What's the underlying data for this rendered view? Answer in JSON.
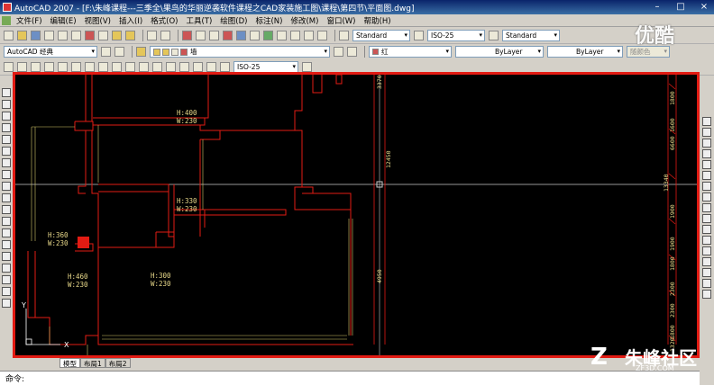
{
  "window": {
    "title": "AutoCAD 2007 - [F:\\朱峰课程---三季全\\果鸟的华丽逆袭软件课程之CAD家装施工图\\课程\\第四节\\平面图.dwg]"
  },
  "menu": [
    "文件(F)",
    "编辑(E)",
    "视图(V)",
    "插入(I)",
    "格式(O)",
    "工具(T)",
    "绘图(D)",
    "标注(N)",
    "修改(M)",
    "窗口(W)",
    "帮助(H)"
  ],
  "toolbar1": {
    "text_style": "Standard",
    "dim_style": "ISO-25",
    "table_style": "Standard"
  },
  "toolbar2": {
    "workspace": "AutoCAD 经典",
    "layer": "墙",
    "color": "红",
    "linetype": "ByLayer",
    "lineweight": "ByLayer",
    "plotstyle": "随颜色"
  },
  "toolbar3": {
    "dim_style": "ISO-25"
  },
  "drawing": {
    "room_labels": [
      {
        "h": "H:400",
        "w": "W:230"
      },
      {
        "h": "H:330",
        "w": "W:230"
      },
      {
        "h": "H:360",
        "w": "W:230"
      },
      {
        "h": "H:460",
        "w": "W:230"
      },
      {
        "h": "H:300",
        "w": "W:230"
      }
    ],
    "dimensions": [
      "3370",
      "12450",
      "4950",
      "13340",
      "1800",
      "1600",
      "6600",
      "1900",
      "1900",
      "1800",
      "2300",
      "2300",
      "1800",
      "1320"
    ],
    "ucs": {
      "x": "X",
      "y": "Y"
    },
    "colors": {
      "wall": "#e21b13",
      "text": "#e9d98a",
      "dim": "#d4c86a",
      "crosshair": "#c8c8c8"
    }
  },
  "layout_tabs": [
    "模型",
    "布局1",
    "布局2"
  ],
  "command": {
    "prompt": "命令:"
  },
  "watermarks": {
    "top": "优酷",
    "bottom_brand": "朱峰社区",
    "bottom_url": "ZF3D.COM"
  },
  "window_controls": [
    "–",
    "□",
    "×"
  ]
}
